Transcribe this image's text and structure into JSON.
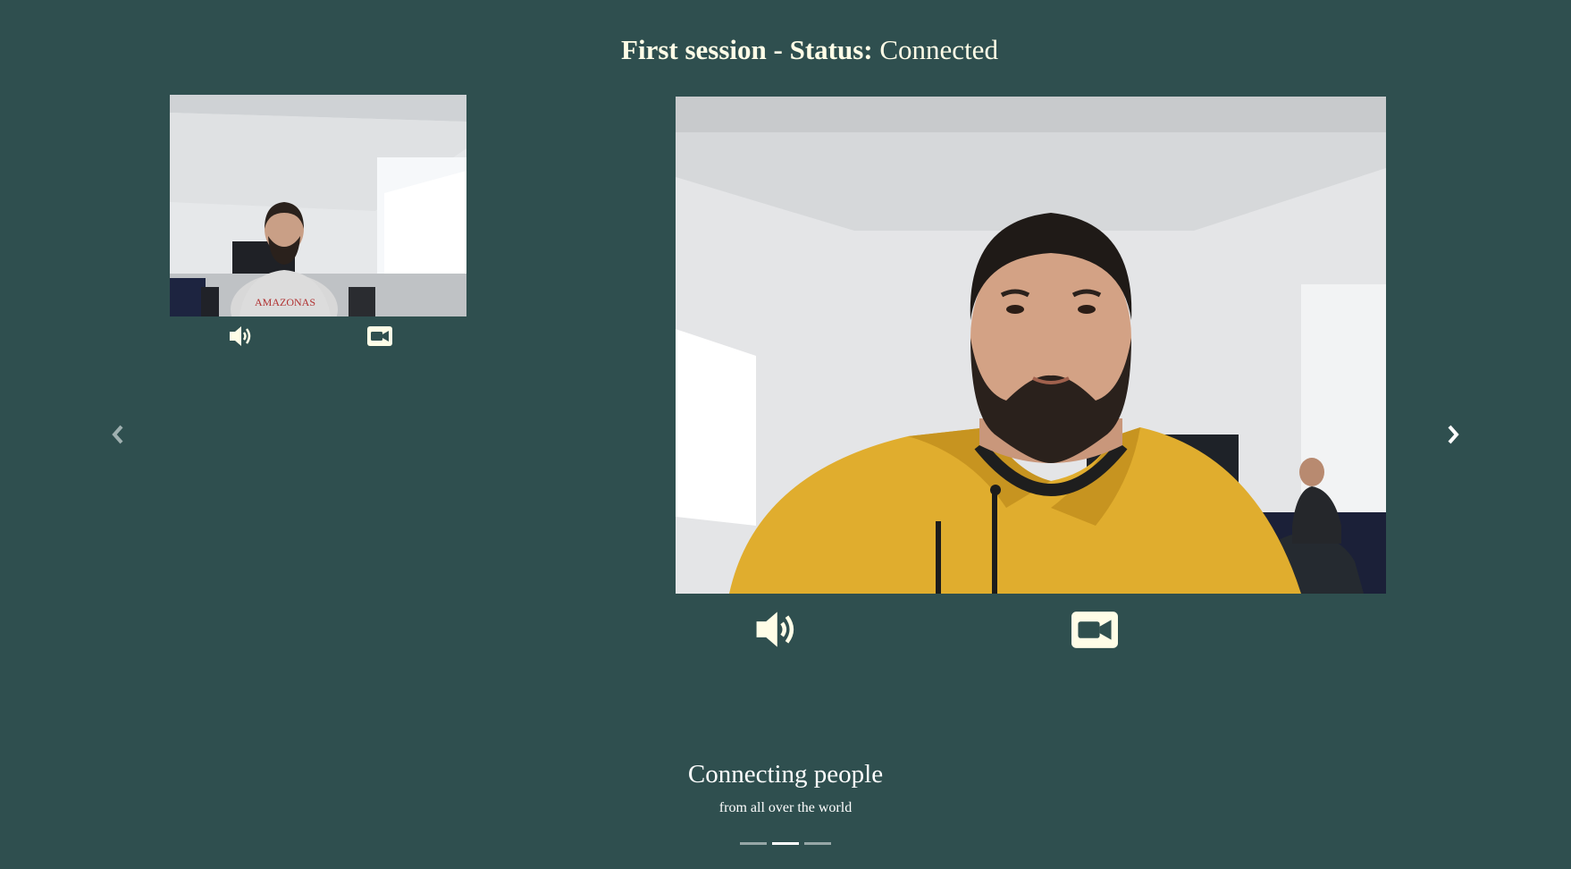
{
  "header": {
    "prefix": "First session - Status:",
    "status": "Connected"
  },
  "local_video": {
    "audio_icon": "speaker-icon",
    "video_icon": "video-camera-icon"
  },
  "remote_video": {
    "audio_icon": "speaker-icon",
    "video_icon": "video-camera-icon"
  },
  "carousel": {
    "prev_icon": "chevron-left-icon",
    "next_icon": "chevron-right-icon",
    "caption_title": "Connecting people",
    "caption_subtitle": "from all over the world",
    "indicator_count": 3,
    "active_index": 1
  },
  "colors": {
    "background": "#2f4f4f",
    "icon": "#fffde7",
    "text": "#ffffff"
  }
}
